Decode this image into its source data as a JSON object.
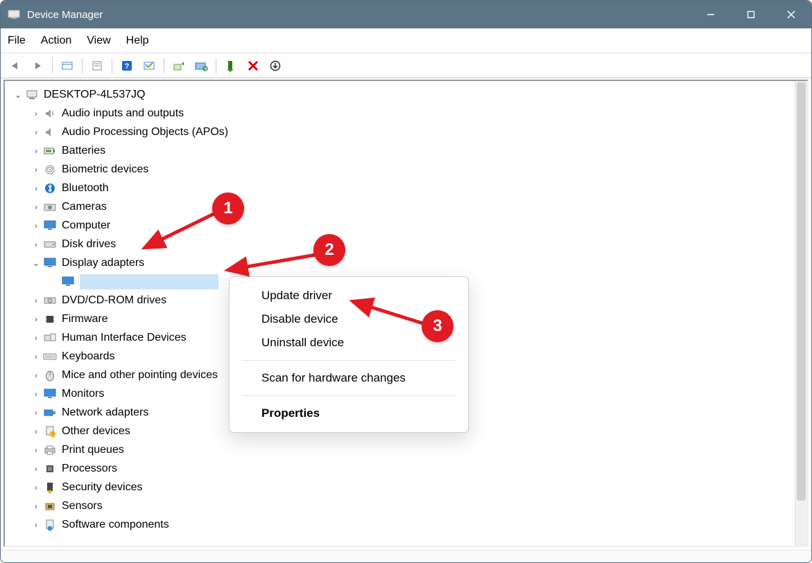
{
  "window": {
    "title": "Device Manager"
  },
  "menubar": [
    "File",
    "Action",
    "View",
    "Help"
  ],
  "toolbar": {
    "back": "Back",
    "forward": "Forward",
    "show_hidden": "Show hidden",
    "refresh": "Refresh",
    "help": "Help",
    "properties": "Properties",
    "update": "Update driver",
    "scan": "Scan for hardware changes",
    "plug": "Add legacy hardware",
    "remove": "Uninstall device",
    "more": "More"
  },
  "tree": {
    "root": {
      "label": "DESKTOP-4L537JQ",
      "expanded": true
    },
    "items": [
      {
        "label": "Audio inputs and outputs",
        "icon": "speaker"
      },
      {
        "label": "Audio Processing Objects (APOs)",
        "icon": "speaker"
      },
      {
        "label": "Batteries",
        "icon": "battery"
      },
      {
        "label": "Biometric devices",
        "icon": "fingerprint"
      },
      {
        "label": "Bluetooth",
        "icon": "bluetooth"
      },
      {
        "label": "Cameras",
        "icon": "camera"
      },
      {
        "label": "Computer",
        "icon": "computer"
      },
      {
        "label": "Disk drives",
        "icon": "disk"
      },
      {
        "label": "Display adapters",
        "icon": "display",
        "expanded": true,
        "children": [
          {
            "label": "",
            "icon": "gpu",
            "selected": true
          }
        ]
      },
      {
        "label": "DVD/CD-ROM drives",
        "icon": "cdrom"
      },
      {
        "label": "Firmware",
        "icon": "chip"
      },
      {
        "label": "Human Interface Devices",
        "icon": "hid"
      },
      {
        "label": "Keyboards",
        "icon": "keyboard"
      },
      {
        "label": "Mice and other pointing devices",
        "icon": "mouse"
      },
      {
        "label": "Monitors",
        "icon": "monitor"
      },
      {
        "label": "Network adapters",
        "icon": "netadapter"
      },
      {
        "label": "Other devices",
        "icon": "other"
      },
      {
        "label": "Print queues",
        "icon": "printer"
      },
      {
        "label": "Processors",
        "icon": "cpu"
      },
      {
        "label": "Security devices",
        "icon": "security"
      },
      {
        "label": "Sensors",
        "icon": "sensor"
      },
      {
        "label": "Software components",
        "icon": "software"
      }
    ]
  },
  "context_menu": {
    "update": "Update driver",
    "disable": "Disable device",
    "uninstall": "Uninstall device",
    "scan": "Scan for hardware changes",
    "properties": "Properties"
  },
  "callouts": {
    "one": "1",
    "two": "2",
    "three": "3"
  }
}
